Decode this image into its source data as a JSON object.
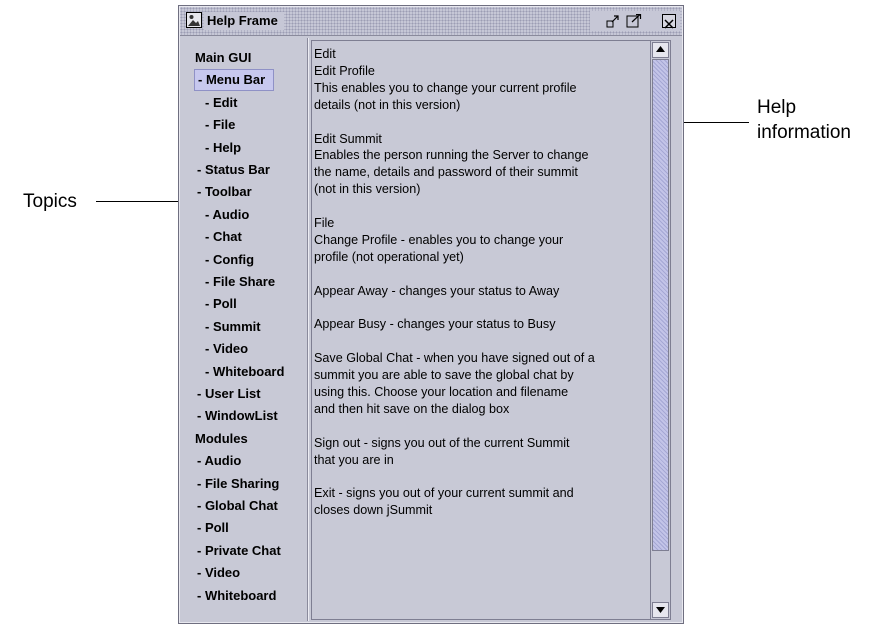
{
  "window": {
    "title": "Help Frame",
    "controls": {
      "minimize_glyph": "↗",
      "maximize_glyph": "⤢"
    }
  },
  "topics": [
    "Main GUI",
    "- Menu Bar",
    "- Edit",
    "- File",
    "- Help",
    "- Status Bar",
    "- Toolbar",
    "- Audio",
    "- Chat",
    "- Config",
    "- File Share",
    "- Poll",
    "- Summit",
    "- Video",
    "- Whiteboard",
    "- User List",
    "- WindowList",
    "Modules",
    "- Audio",
    "- File Sharing",
    "- Global Chat",
    "- Poll",
    "- Private Chat",
    "- Video",
    "- Whiteboard"
  ],
  "selected_topic": "- Menu Bar",
  "help_text_lines": [
    "Edit",
    "Edit Profile",
    "This enables you to change your current profile",
    "details (not in this version)",
    "",
    "Edit Summit",
    "Enables the person running the Server to change",
    "the name, details and password of their summit",
    "(not in this version)",
    "",
    "File",
    "Change Profile - enables you to change your",
    "profile (not operational yet)",
    "",
    "Appear Away - changes your status to Away",
    "",
    "Appear Busy - changes your status to Busy",
    "",
    "Save Global Chat - when you have signed out of a",
    "summit you are able to save the global chat by",
    "using this. Choose your location and filename",
    "and then hit save on the dialog box",
    "",
    "Sign out - signs you out of the current Summit",
    "that you are in",
    "",
    "Exit - signs you out of your current summit and",
    "closes down jSummit"
  ],
  "annotations": {
    "topics_label": "Topics",
    "help_label_line1": "Help",
    "help_label_line2": "information"
  },
  "colors": {
    "window_bg": "#c8c9d6",
    "selected_topic_bg": "#c7c8ee",
    "scroll_thumb": "#c3c4e8"
  },
  "icons": {
    "app_icon": "window-image-icon",
    "minimize": "minimize-icon",
    "maximize": "maximize-icon",
    "close": "close-icon",
    "scroll_up": "arrow-up-icon",
    "scroll_down": "arrow-down-icon"
  }
}
